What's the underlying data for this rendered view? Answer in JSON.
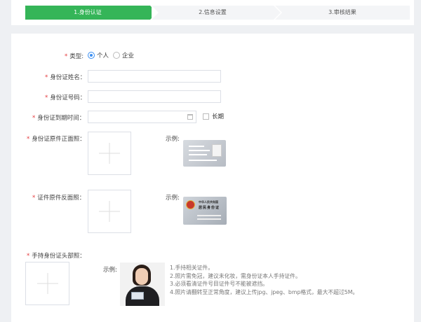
{
  "steps": [
    {
      "label": "1.身份认证"
    },
    {
      "label": "2.信息设置"
    },
    {
      "label": "3.审核结果"
    }
  ],
  "form": {
    "required_mark": "*",
    "type": {
      "label": "类型:",
      "options": [
        {
          "label": "个人",
          "selected": true
        },
        {
          "label": "企业",
          "selected": false
        }
      ]
    },
    "id_name": {
      "label": "身份证姓名：",
      "value": "",
      "placeholder": ""
    },
    "id_number": {
      "label": "身份证号码：",
      "value": "",
      "placeholder": ""
    },
    "id_expiry": {
      "label": "身份证到期时间：",
      "value": "",
      "placeholder": "",
      "long_term_label": "长期"
    },
    "id_front": {
      "label": "身份证原件正面照：",
      "sample_label": "示例:"
    },
    "id_back": {
      "label": "证件原件反面照：",
      "sample_label": "示例:"
    },
    "id_handheld": {
      "label": "手持身份证头部照：",
      "sample_label": "示例:"
    },
    "id_back_sample": {
      "line1": "中华人民共和国",
      "line2": "居民身份证"
    },
    "tips": [
      "1.手持相关证件。",
      "2.照片需免冠，建议未化妆，需身份证本人手持证件。",
      "3.必须看清证件号目证件号不能被遮挡。",
      "4.照片请翻转至正常角度，建议上传jpg、jpeg、bmp格式，最大不超过5M。"
    ]
  },
  "colors": {
    "accent": "#35b558",
    "required": "#e4393c",
    "radio": "#3b8ff2"
  }
}
